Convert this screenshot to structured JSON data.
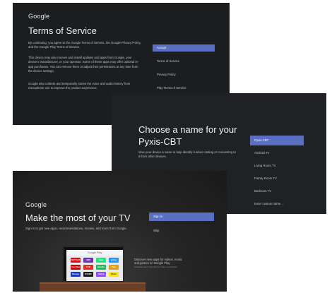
{
  "screen1": {
    "logo": "Google",
    "title": "Terms of Service",
    "paragraphs": [
      "By continuing, you agree to the Google Terms of Service, the Google Privacy Policy, and the Google Play Terms of Service.",
      "This device may also receive and install updates and apps from Google, your device's manufacturer, or your operator. Some of these apps may offer optional in-app purchases. You can remove them or adjust their permissions at any time from the device settings.",
      "Google also collects and temporarily stores the voice and audio history from microphone use to improve the product experience."
    ],
    "menu": [
      "Accept",
      "Terms of Service",
      "Privacy Policy",
      "Play Terms of Service"
    ]
  },
  "screen2": {
    "title_line1": "Choose a name for your",
    "title_line2": "Pyxis-CBT",
    "description": "Give your device a name to help identify it when casting or connecting to it from other devices.",
    "menu": [
      "Pyxis-CBT",
      "Android TV",
      "Living Room TV",
      "Family Room TV",
      "Bedroom TV",
      "Enter custom name..."
    ]
  },
  "screen3": {
    "logo": "Google",
    "title": "Make the most of your TV",
    "description": "Sign in to get new apps, recommendations, movies, and more from Google.",
    "menu": [
      "Sign in",
      "Skip"
    ],
    "tv_header": "Google Play",
    "apps": [
      {
        "label": "NETFLIX",
        "color": "#e50914"
      },
      {
        "label": "HBO",
        "color": "#6b2fbf"
      },
      {
        "label": "hulu",
        "color": "#1ce783"
      },
      {
        "label": "prime",
        "color": "#1a98ff"
      },
      {
        "label": "YouTube",
        "color": "#cc0000"
      },
      {
        "label": "TED",
        "color": "#e62b1e"
      },
      {
        "label": "Spotify",
        "color": "#1db954"
      },
      {
        "label": "Plex",
        "color": "#e5a00d"
      },
      {
        "label": "Disney",
        "color": "#113ccf"
      },
      {
        "label": "STARZ",
        "color": "#1b1b1b"
      },
      {
        "label": "Twitch",
        "color": "#9146ff"
      },
      {
        "label": "Pluto",
        "color": "#ffe600"
      }
    ],
    "caption": "Discover new apps for videos, music and games on Google Play",
    "caption_sub": "Available apps may vary by region and device"
  }
}
